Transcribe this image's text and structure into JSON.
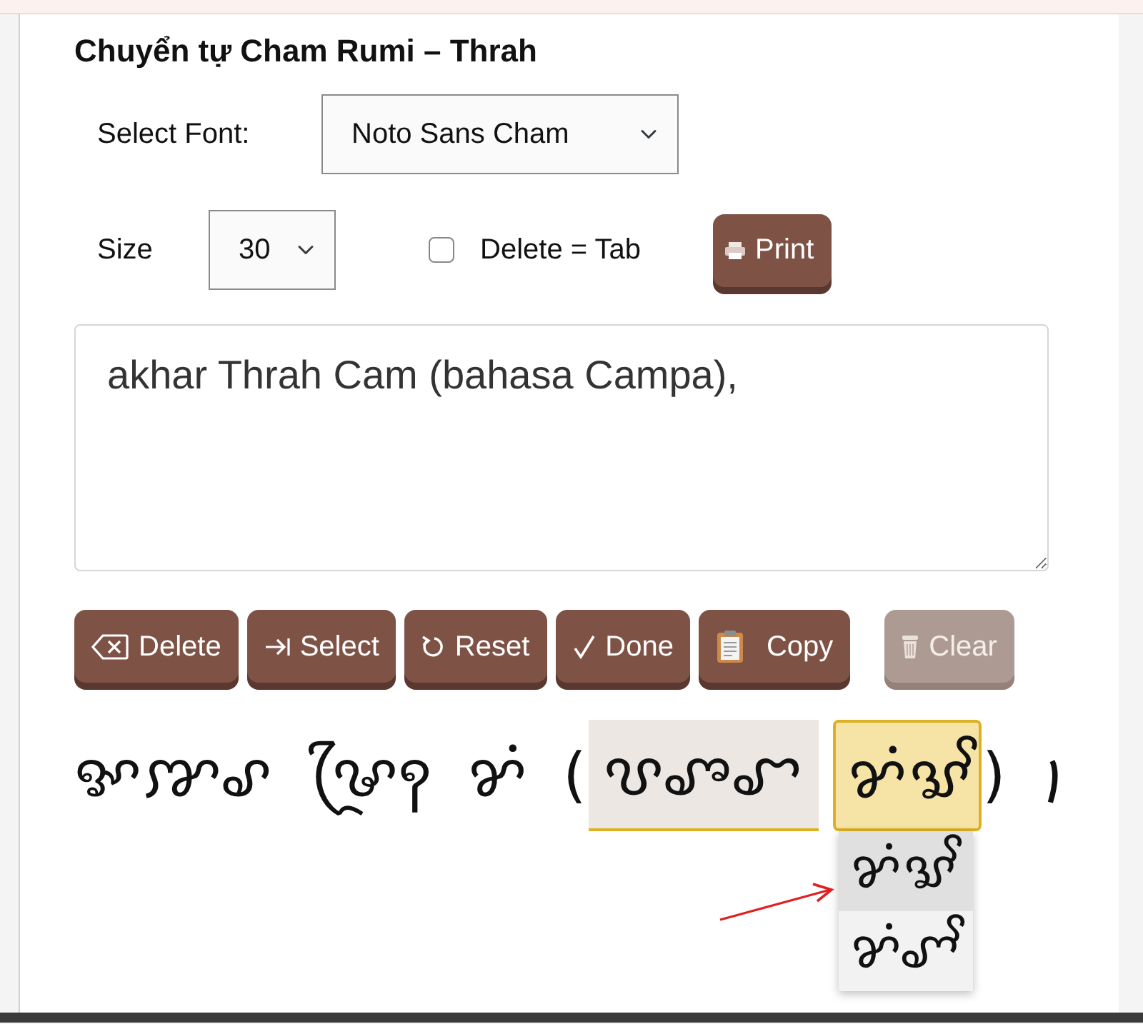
{
  "title": "Chuyển tự Cham Rumi – Thrah",
  "font_select": {
    "label": "Select Font:",
    "value": "Noto Sans Cham"
  },
  "size_select": {
    "label": "Size",
    "value": "30"
  },
  "delete_tab": {
    "label": "Delete = Tab",
    "checked": false
  },
  "print_button": {
    "label": "Print"
  },
  "input": {
    "value": "akhar Thrah Cam (bahasa Campa),"
  },
  "buttons": [
    {
      "label": "Delete",
      "disabled": false
    },
    {
      "label": "Select",
      "disabled": false
    },
    {
      "label": "Reset",
      "disabled": false
    },
    {
      "label": "Done",
      "disabled": false
    },
    {
      "label": "Copy",
      "disabled": false
    },
    {
      "label": "Clear",
      "disabled": true
    }
  ],
  "output": [
    {
      "kind": "plain",
      "text": "ꨀꨇꨣ ꨔꨴꩍ ꨌꩌ ("
    },
    {
      "kind": "candidate",
      "text": "ꨝꨨꨧ",
      "selected": false,
      "expanded": false
    },
    {
      "kind": "candidate",
      "text": "ꨌꩌꨛꨩ",
      "selected": true,
      "expanded": true,
      "options": [
        {
          "text": "ꨌꩌꨛꨩ",
          "selected": true
        },
        {
          "text": "ꨌꩌꨚꨩ",
          "selected": false
        }
      ]
    },
    {
      "kind": "plain",
      "text": ") ꩝"
    }
  ]
}
